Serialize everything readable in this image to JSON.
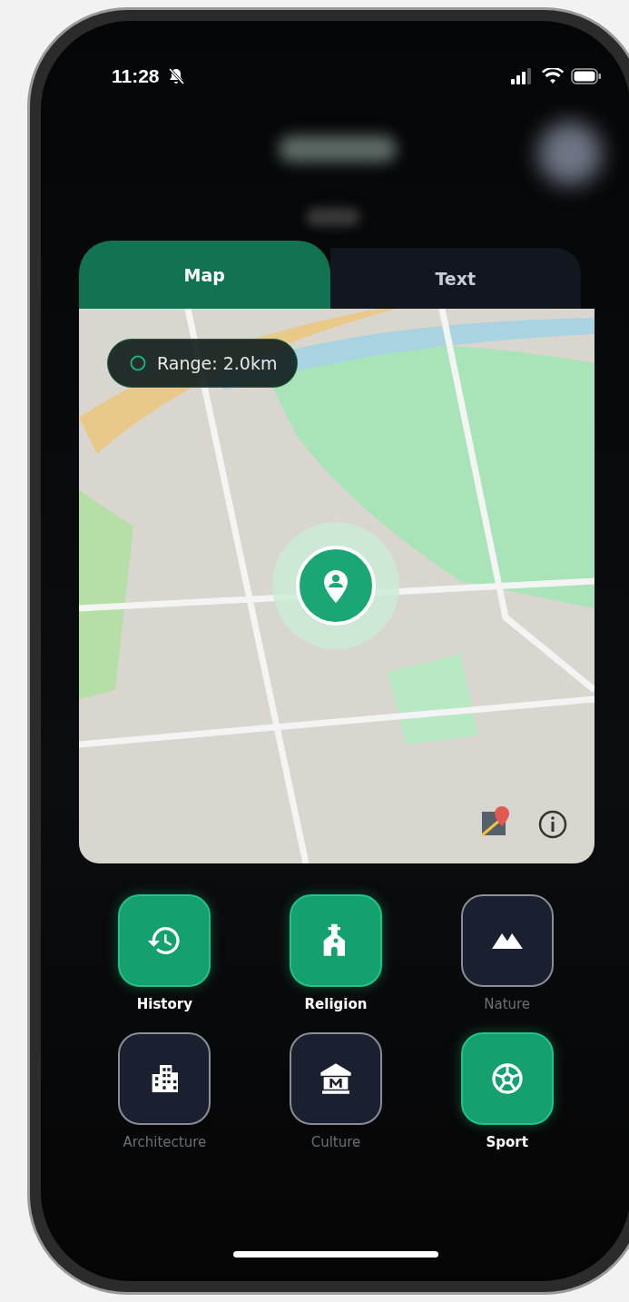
{
  "status_bar": {
    "time": "11:28"
  },
  "tabs": [
    {
      "label": "Map",
      "selected": true
    },
    {
      "label": "Text",
      "selected": false
    }
  ],
  "map": {
    "range": "Range: 2.0km"
  },
  "categories": [
    {
      "label": "History",
      "selected": true
    },
    {
      "label": "Religion",
      "selected": true
    },
    {
      "label": "Nature",
      "selected": false
    },
    {
      "label": "Architecture",
      "selected": false
    },
    {
      "label": "Culture",
      "selected": false
    },
    {
      "label": "Sport",
      "selected": true
    }
  ]
}
